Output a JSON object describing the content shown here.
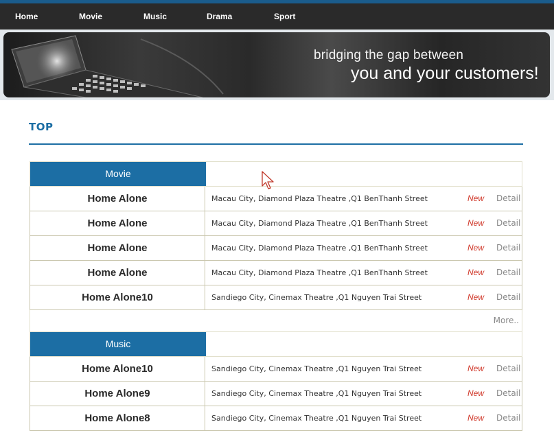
{
  "nav": {
    "items": [
      {
        "label": "Home"
      },
      {
        "label": "Movie"
      },
      {
        "label": "Music"
      },
      {
        "label": "Drama"
      },
      {
        "label": "Sport"
      }
    ]
  },
  "banner": {
    "line1": "bridging the gap between",
    "line2": "you and your customers!"
  },
  "main": {
    "title": "TOP",
    "sections": [
      {
        "label": "Movie",
        "rows": [
          {
            "name": "Home Alone",
            "location": "Macau City, Diamond Plaza Theatre ,Q1 BenThanh Street",
            "badge": "New",
            "detail": "Detail"
          },
          {
            "name": "Home Alone",
            "location": "Macau City, Diamond Plaza Theatre ,Q1 BenThanh Street",
            "badge": "New",
            "detail": "Detail"
          },
          {
            "name": "Home Alone",
            "location": "Macau City, Diamond Plaza Theatre ,Q1 BenThanh Street",
            "badge": "New",
            "detail": "Detail"
          },
          {
            "name": "Home Alone",
            "location": "Macau City, Diamond Plaza Theatre ,Q1 BenThanh Street",
            "badge": "New",
            "detail": "Detail"
          },
          {
            "name": "Home Alone10",
            "location": "Sandiego City, Cinemax Theatre ,Q1 Nguyen Trai Street",
            "badge": "New",
            "detail": "Detail"
          }
        ],
        "more": "More.."
      },
      {
        "label": "Music",
        "rows": [
          {
            "name": "Home Alone10",
            "location": "Sandiego City, Cinemax Theatre ,Q1 Nguyen Trai Street",
            "badge": "New",
            "detail": "Detail"
          },
          {
            "name": "Home Alone9",
            "location": "Sandiego City, Cinemax Theatre ,Q1 Nguyen Trai Street",
            "badge": "New",
            "detail": "Detail"
          },
          {
            "name": "Home Alone8",
            "location": "Sandiego City, Cinemax Theatre ,Q1 Nguyen Trai Street",
            "badge": "New",
            "detail": "Detail"
          }
        ]
      }
    ]
  },
  "colors": {
    "accent": "#1c6ea4",
    "nav_bg": "#2a2a2a",
    "badge_new": "#d0392b"
  },
  "icons": {
    "cursor": "mouse-pointer-icon"
  }
}
